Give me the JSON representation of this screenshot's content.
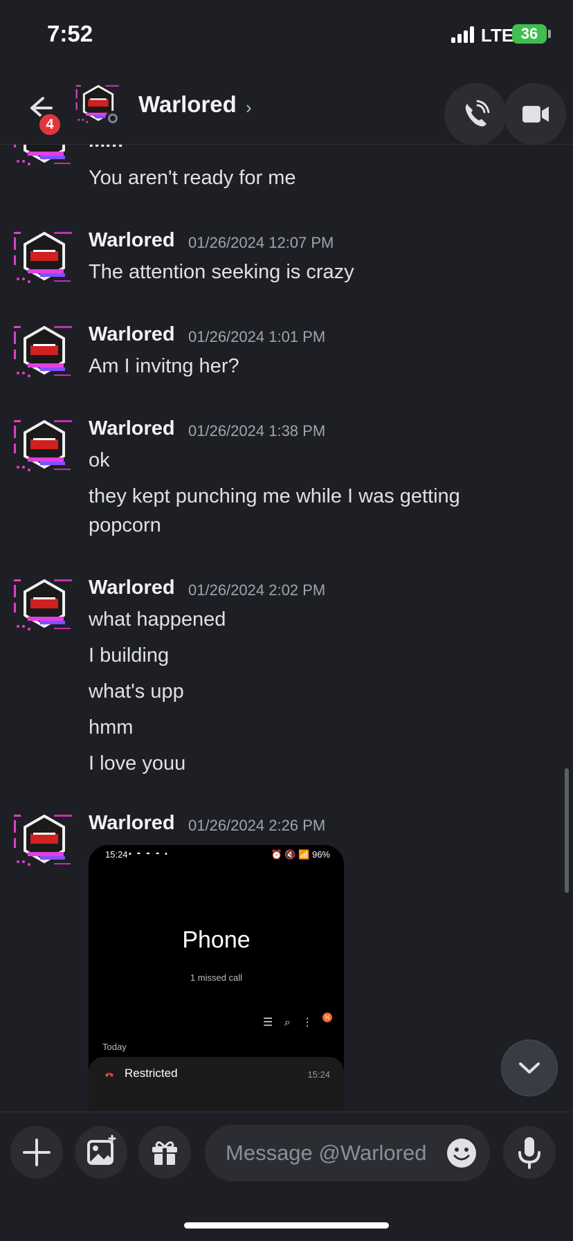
{
  "status": {
    "time": "7:52",
    "network": "LTE",
    "battery": "36"
  },
  "header": {
    "back_badge": "4",
    "name": "Warlored",
    "chevron": "›"
  },
  "partial_top": {
    "author": "Mm",
    "text": "You aren't ready for me"
  },
  "groups": [
    {
      "author": "Warlored",
      "timestamp": "01/26/2024 12:07 PM",
      "lines": [
        "The attention seeking is crazy"
      ]
    },
    {
      "author": "Warlored",
      "timestamp": "01/26/2024 1:01 PM",
      "lines": [
        "Am I invitng her?"
      ]
    },
    {
      "author": "Warlored",
      "timestamp": "01/26/2024 1:38 PM",
      "lines": [
        "ok",
        "they kept punching me while I was getting",
        "popcorn"
      ]
    },
    {
      "author": "Warlored",
      "timestamp": "01/26/2024 2:02 PM",
      "lines": [
        "what happened",
        "I building",
        "what's upp",
        "hmm",
        "I love youu"
      ]
    },
    {
      "author": "Warlored",
      "timestamp": "01/26/2024 2:26 PM",
      "lines": []
    }
  ],
  "embed": {
    "status_time": "15:24",
    "status_icons": "▪ ◓ ◓ ◓ •",
    "status_right": "⏰ 🔇 📶 96%",
    "title": "Phone",
    "subtitle": "1 missed call",
    "tools": "☰  ⌕  ⋮",
    "n_badge": "N",
    "section": "Today",
    "call_name": "Restricted",
    "call_time": "15:24"
  },
  "composer": {
    "placeholder": "Message @Warlored"
  },
  "icons": {
    "back": "arrow-left-icon",
    "call": "phone-icon",
    "video": "video-camera-icon",
    "jump": "chevron-down-icon",
    "plus": "plus-icon",
    "image": "image-icon",
    "gift": "gift-icon",
    "emoji": "emoji-icon",
    "mic": "microphone-icon"
  },
  "colors": {
    "background": "#1e1f24",
    "badge": "#e2363f",
    "battery": "#3fbf4f"
  }
}
